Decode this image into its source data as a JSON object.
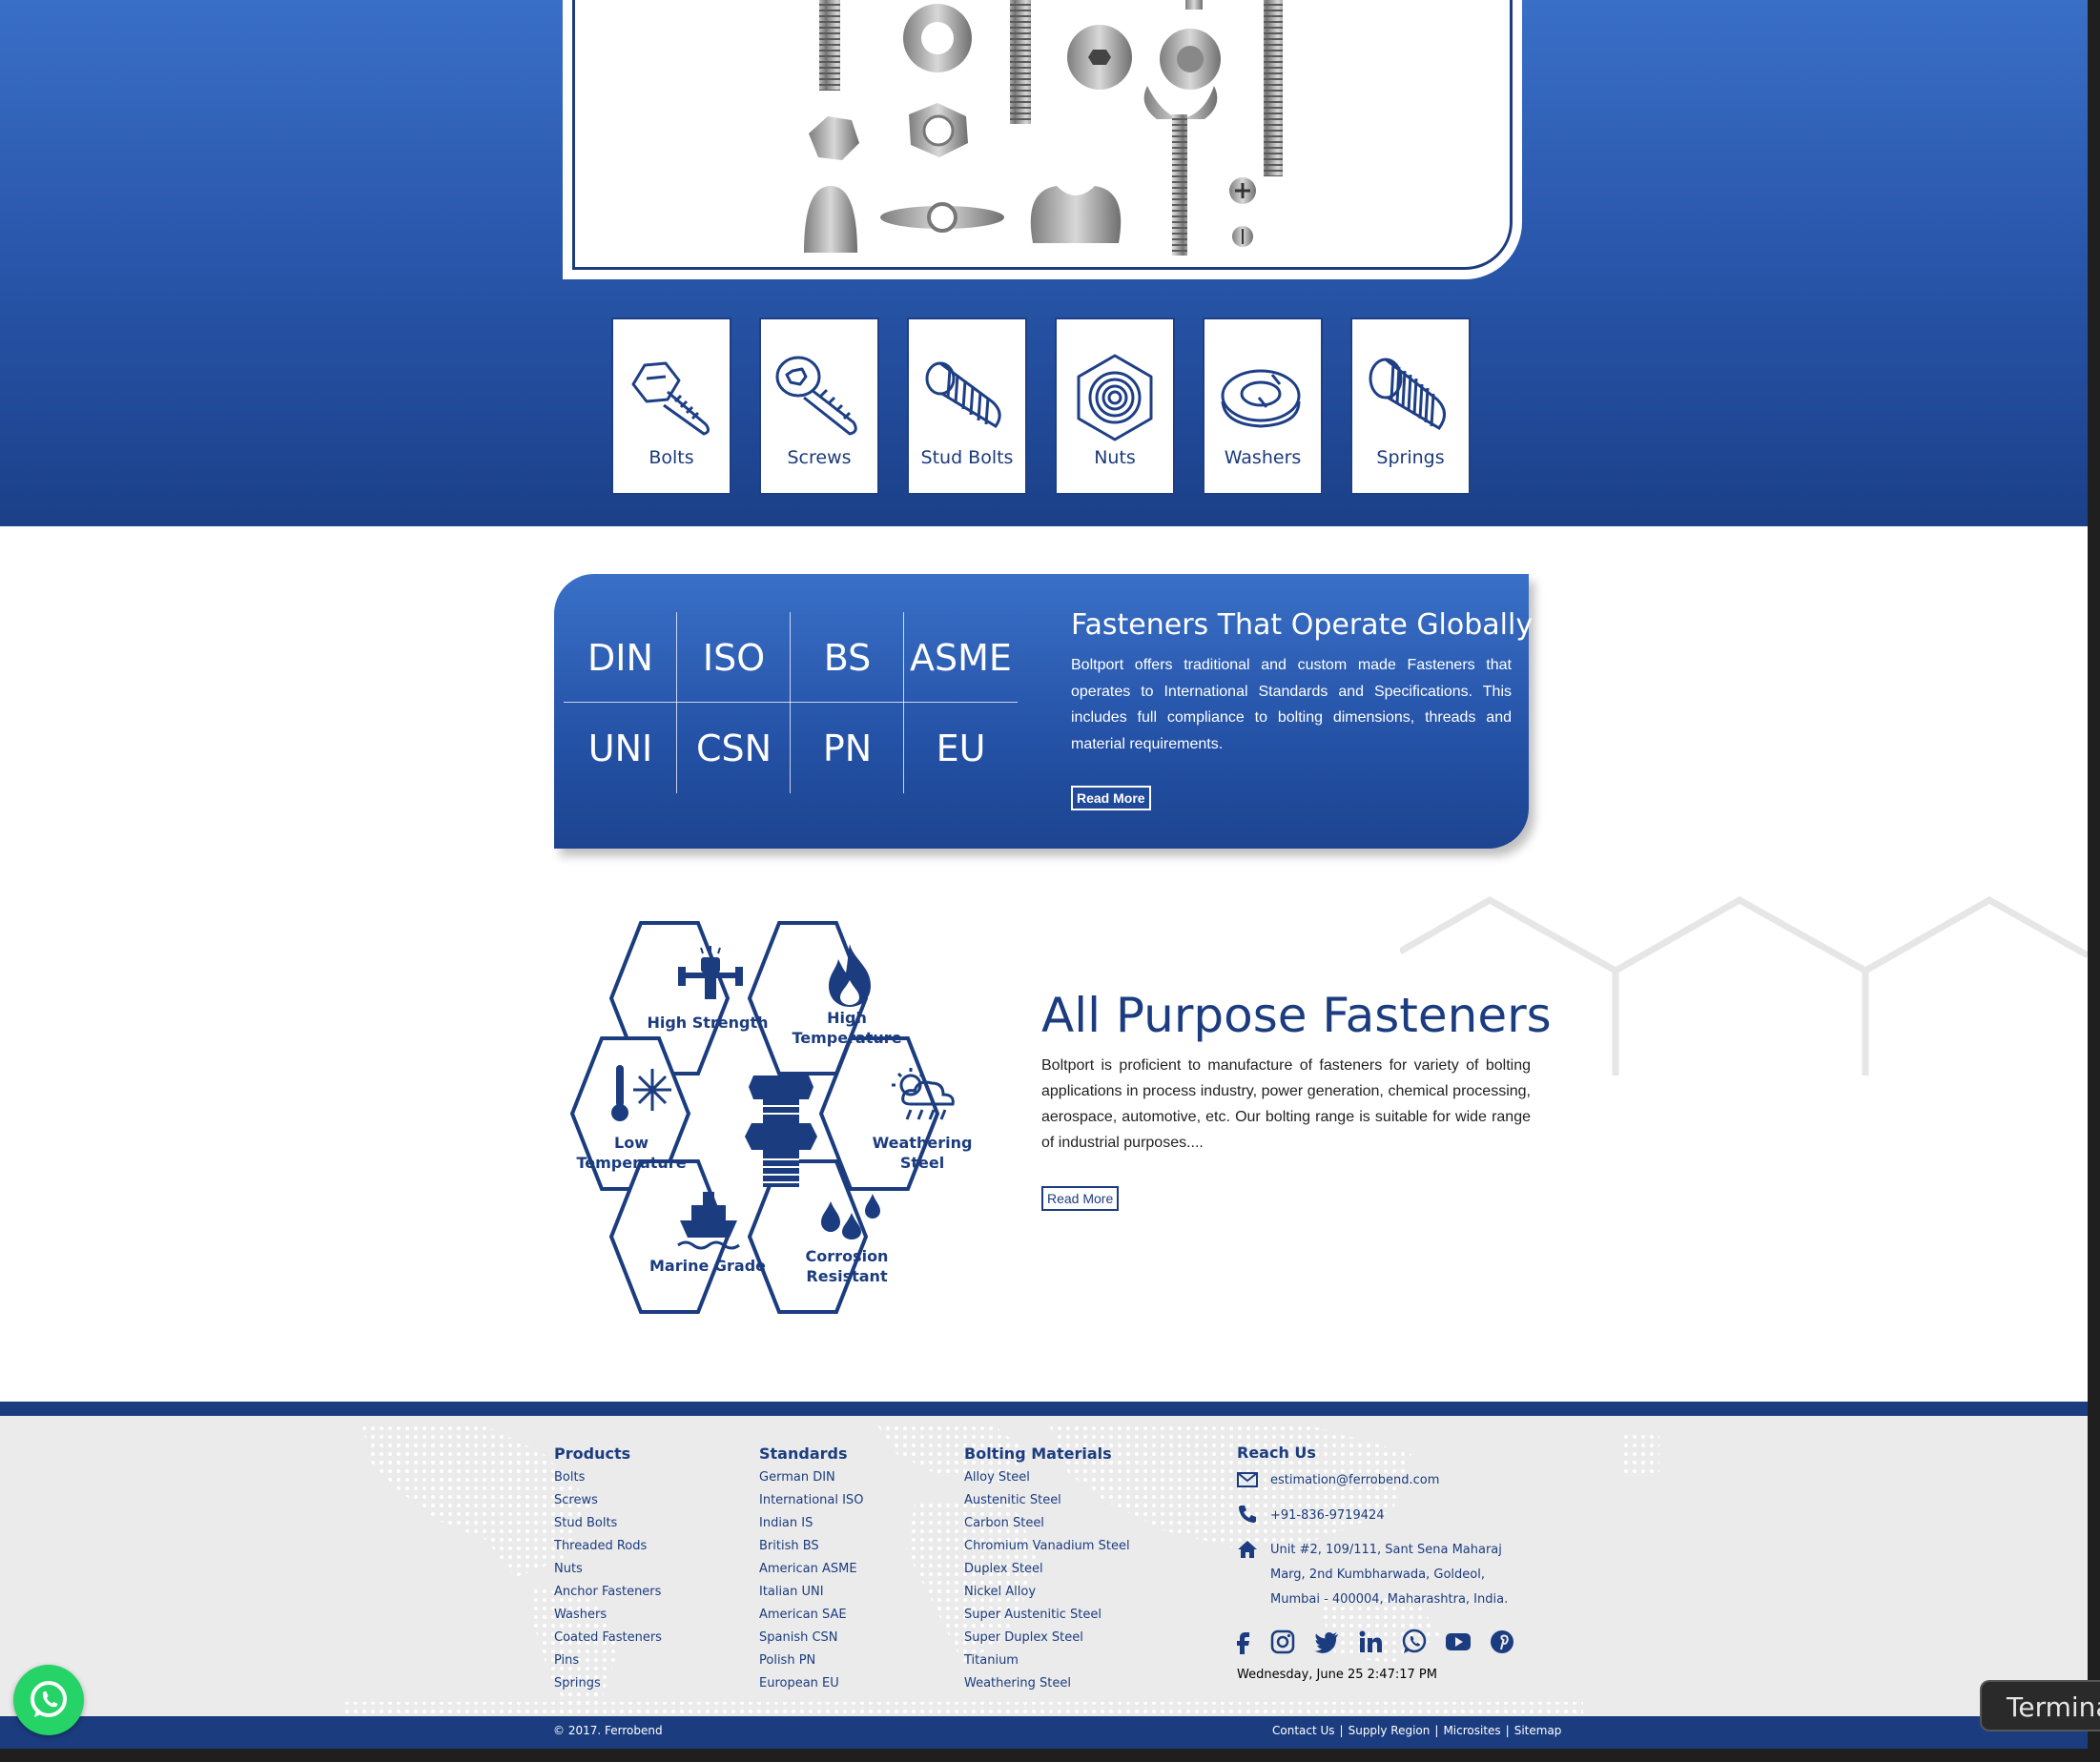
{
  "categories": [
    {
      "label": "Bolts",
      "icon": "bolt-icon"
    },
    {
      "label": "Screws",
      "icon": "screw-icon"
    },
    {
      "label": "Stud Bolts",
      "icon": "stud-bolt-icon"
    },
    {
      "label": "Nuts",
      "icon": "nut-icon"
    },
    {
      "label": "Washers",
      "icon": "washer-icon"
    },
    {
      "label": "Springs",
      "icon": "spring-icon"
    }
  ],
  "standards": {
    "row1": [
      "DIN",
      "ISO",
      "BS",
      "ASME"
    ],
    "row2": [
      "UNI",
      "CSN",
      "PN",
      "EU"
    ]
  },
  "global": {
    "title": "Fasteners That Operate Globally",
    "text": "Boltport offers traditional and custom made Fasteners that operates to International Standards and Specifications. This includes full compliance to bolting dimensions, threads and material requirements.",
    "button": "Read More"
  },
  "hexes": {
    "high_strength": "High Strength",
    "high_temp_1": "High",
    "high_temp_2": "Temperature",
    "low_temp_1": "Low",
    "low_temp_2": "Temperature",
    "weathering_1": "Weathering",
    "weathering_2": "Steel",
    "marine": "Marine Grade",
    "corrosion_1": "Corrosion",
    "corrosion_2": "Resistant"
  },
  "all_purpose": {
    "title": "All Purpose Fasteners",
    "text": "Boltport is proficient to manufacture of fasteners for variety of bolting applications in process industry, power generation, chemical processing, aerospace, automotive, etc. Our bolting range is suitable for wide range of industrial purposes....",
    "button": "Read More"
  },
  "footer": {
    "products": {
      "heading": "Products",
      "items": [
        "Bolts",
        "Screws",
        "Stud Bolts",
        "Threaded Rods",
        "Nuts",
        "Anchor Fasteners",
        "Washers",
        "Coated Fasteners",
        "Pins",
        "Springs"
      ]
    },
    "standards": {
      "heading": "Standards",
      "items": [
        "German DIN",
        "International ISO",
        "Indian IS",
        "British BS",
        "American ASME",
        "Italian UNI",
        "American SAE",
        "Spanish CSN",
        "Polish PN",
        "European EU"
      ]
    },
    "materials": {
      "heading": "Bolting Materials",
      "items": [
        "Alloy Steel",
        "Austenitic Steel",
        "Carbon Steel",
        "Chromium Vanadium Steel",
        "Duplex Steel",
        "Nickel Alloy",
        "Super Austenitic Steel",
        "Super Duplex Steel",
        "Titanium",
        "Weathering Steel"
      ]
    },
    "reach": {
      "heading": "Reach Us",
      "email": "estimation@ferrobend.com",
      "phone": "+91-836-9719424",
      "address_1": "Unit #2, 109/111, Sant Sena Maharaj",
      "address_2": "Marg, 2nd Kumbharwada, Goldeol,",
      "address_3": "Mumbai - 400004, Maharashtra, India."
    },
    "social": [
      "facebook-icon",
      "instagram-icon",
      "twitter-icon",
      "linkedin-icon",
      "whatsapp-icon",
      "youtube-icon",
      "pinterest-icon"
    ],
    "datetime": "Wednesday, June 25 2:47:17 PM",
    "copyright": "© 2017. Ferrobend",
    "bottom_links": [
      "Contact Us",
      "Supply Region",
      "Microsites",
      "Sitemap"
    ]
  },
  "terminal_tip": "Termina",
  "colors": {
    "brand_blue": "#1b3c7f",
    "hero_top": "#3a6fc7",
    "hero_bottom": "#1b4089",
    "footer_bg": "#ebebeb",
    "whatsapp": "#25d366"
  }
}
